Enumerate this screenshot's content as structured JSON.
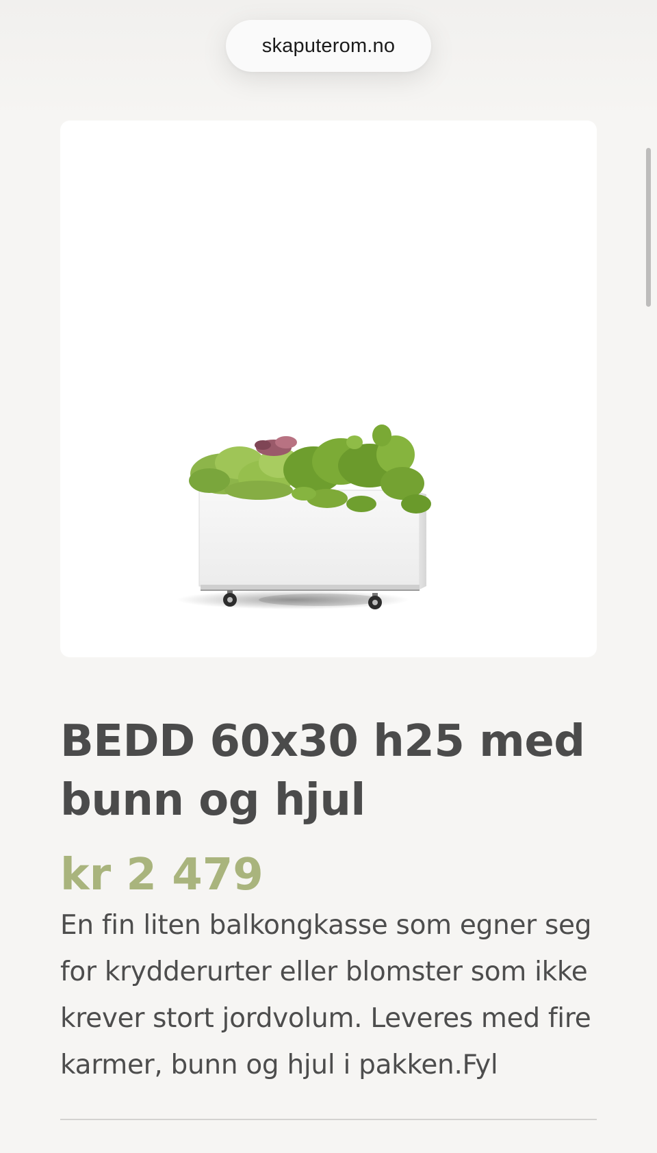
{
  "browser": {
    "url": "skaputerom.no"
  },
  "product": {
    "image_alt": "White planter box on wheels filled with herbs",
    "title": "BEDD 60x30 h25 med bunn og hjul",
    "price": "kr 2 479",
    "description": "En fin liten balkongkasse som egner seg for krydderurter eller blomster som ikke krever stort jordvolum. Leveres med fire karmer, bunn og hjul i pakken.Fyl"
  },
  "colors": {
    "background": "#f6f5f3",
    "title": "#4b4b4b",
    "price": "#a9b47d",
    "text": "#4d4d4d"
  }
}
